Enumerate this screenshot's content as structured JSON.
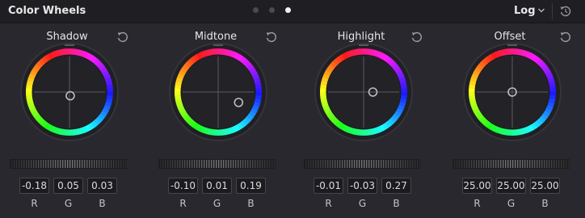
{
  "header": {
    "title": "Color Wheels",
    "page_indicator": {
      "count": 3,
      "active_index": 2
    },
    "mode_select": {
      "value": "Log"
    },
    "reset_icon": "reset-all-icon"
  },
  "wheels": [
    {
      "name": "Shadow",
      "values": [
        "-0.18",
        "0.05",
        "0.03"
      ],
      "puck": {
        "x": 0.02,
        "y": -0.1
      }
    },
    {
      "name": "Midtone",
      "values": [
        "-0.10",
        "0.01",
        "0.19"
      ],
      "puck": {
        "x": 0.55,
        "y": -0.28
      }
    },
    {
      "name": "Highlight",
      "values": [
        "-0.01",
        "-0.03",
        "0.27"
      ],
      "puck": {
        "x": 0.25,
        "y": 0.0
      }
    },
    {
      "name": "Offset",
      "values": [
        "25.00",
        "25.00",
        "25.00"
      ],
      "puck": {
        "x": 0.0,
        "y": 0.0
      }
    }
  ],
  "channel_labels": [
    "R",
    "G",
    "B"
  ],
  "colors": {
    "background": "#28282e",
    "header_bg": "#1f1f23",
    "text": "#d6d6d6",
    "field_bg": "#1c1c20"
  }
}
